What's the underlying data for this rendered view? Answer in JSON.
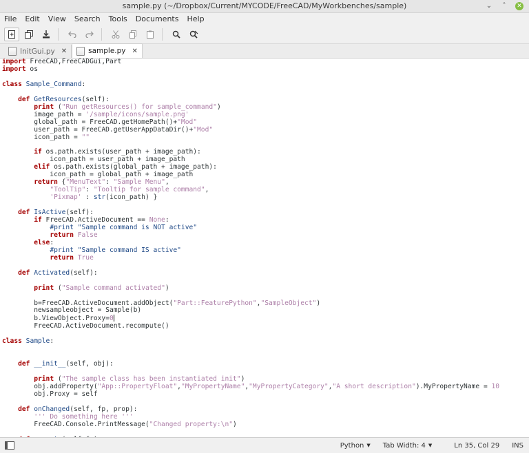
{
  "window": {
    "title": "sample.py (~/Dropbox/Current/MYCODE/FreeCAD/MyWorkbenches/sample)",
    "minimize_glyph": "⌄",
    "maximize_glyph": "˄",
    "close_glyph": "✕"
  },
  "menu": [
    "File",
    "Edit",
    "View",
    "Search",
    "Tools",
    "Documents",
    "Help"
  ],
  "toolbar": {
    "new_icon": "new-document-icon",
    "open_icon": "open-document-icon",
    "save_icon": "save-icon",
    "undo_icon": "undo-icon",
    "redo_icon": "redo-icon",
    "cut_icon": "cut-icon",
    "copy_icon": "copy-icon",
    "paste_icon": "paste-icon",
    "find_icon": "search-icon",
    "replace_icon": "find-replace-icon"
  },
  "tabs": [
    {
      "label": "InitGui.py",
      "close": "✕",
      "active": false
    },
    {
      "label": "sample.py",
      "close": "✕",
      "active": true
    }
  ],
  "editor": {
    "language": "Python",
    "lines": [
      "import FreeCAD,FreeCADGui,Part",
      "import os",
      "",
      "class Sample_Command:",
      "",
      "    def GetResources(self):",
      "        print (\"Run getResources() for sample_command\")",
      "        image_path = '/sample/icons/sample.png'",
      "        global_path = FreeCAD.getHomePath()+\"Mod\"",
      "        user_path = FreeCAD.getUserAppDataDir()+\"Mod\"",
      "        icon_path = \"\"",
      "",
      "        if os.path.exists(user_path + image_path):",
      "            icon_path = user_path + image_path",
      "        elif os.path.exists(global_path + image_path):",
      "            icon_path = global_path + image_path",
      "        return {\"MenuText\": \"Sample Menu\",",
      "            \"ToolTip\": \"Tooltip for sample command\",",
      "            'Pixmap' : str(icon_path) }",
      "",
      "    def IsActive(self):",
      "        if FreeCAD.ActiveDocument == None:",
      "            #print \"Sample command is NOT active\"",
      "            return False",
      "        else:",
      "            #print \"Sample command IS active\"",
      "            return True",
      "",
      "    def Activated(self):",
      "",
      "        print (\"Sample command activated\")",
      "",
      "        b=FreeCAD.ActiveDocument.addObject(\"Part::FeaturePython\",\"SampleObject\")",
      "        newsampleobject = Sample(b)",
      "        b.ViewObject.Proxy=0",
      "        FreeCAD.ActiveDocument.recompute()",
      "",
      "class Sample:",
      "",
      "",
      "    def __init__(self, obj):",
      "",
      "        print (\"The sample class has been instantiated init\")",
      "        obj.addProperty(\"App::PropertyFloat\",\"MyPropertyName\",\"MyPropertyCategory\",\"A short description\").MyPropertyName = 10",
      "        obj.Proxy = self",
      "",
      "    def onChanged(self, fp, prop):",
      "        ''' Do something here '''",
      "        FreeCAD.Console.PrintMessage(\"Changed property:\\n\")",
      "",
      "    def execute(self,fp):"
    ],
    "cursor": {
      "line": 35,
      "column": 29
    }
  },
  "status": {
    "language": "Python",
    "tab_width": "Tab Width: 4",
    "position": "Ln 35, Col 29",
    "mode": "INS"
  },
  "colors": {
    "keyword": "#a40000",
    "function": "#204a87",
    "string": "#ad7fa8",
    "comment": "#204a87"
  }
}
